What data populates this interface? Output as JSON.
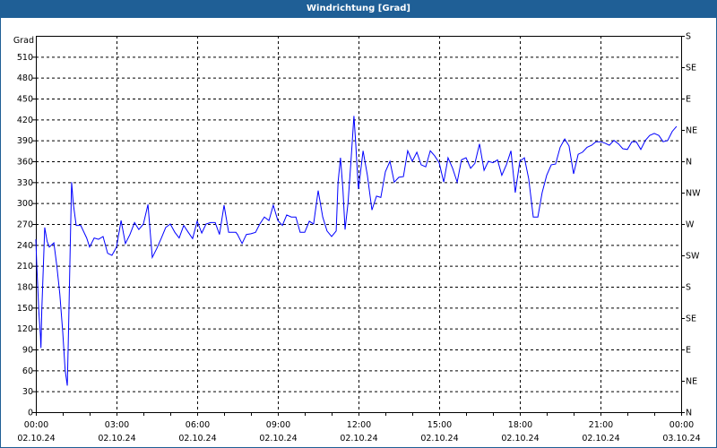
{
  "window": {
    "title": "Windrichtung [Grad]"
  },
  "colors": {
    "title_bar": "#1f5f96",
    "series": "#0000ff",
    "grid": "#000000"
  },
  "chart_data": {
    "type": "line",
    "title": "Windrichtung [Grad]",
    "ylabel": "Grad",
    "ylim": [
      0,
      540
    ],
    "xlim_hours": [
      0,
      24
    ],
    "grid": true,
    "y_ticks": [
      0,
      30,
      60,
      90,
      120,
      150,
      180,
      210,
      240,
      270,
      300,
      330,
      360,
      390,
      420,
      450,
      480,
      510
    ],
    "right_axis": [
      {
        "value": 0,
        "label": "N"
      },
      {
        "value": 45,
        "label": "NE"
      },
      {
        "value": 90,
        "label": "E"
      },
      {
        "value": 135,
        "label": "SE"
      },
      {
        "value": 180,
        "label": "S"
      },
      {
        "value": 225,
        "label": "SW"
      },
      {
        "value": 270,
        "label": "W"
      },
      {
        "value": 315,
        "label": "NW"
      },
      {
        "value": 360,
        "label": "N"
      },
      {
        "value": 405,
        "label": "NE"
      },
      {
        "value": 450,
        "label": "E"
      },
      {
        "value": 495,
        "label": "SE"
      },
      {
        "value": 540,
        "label": "S"
      }
    ],
    "x_ticks": [
      {
        "hour": 0,
        "time": "00:00",
        "date": "02.10.24"
      },
      {
        "hour": 3,
        "time": "03:00",
        "date": "02.10.24"
      },
      {
        "hour": 6,
        "time": "06:00",
        "date": "02.10.24"
      },
      {
        "hour": 9,
        "time": "09:00",
        "date": "02.10.24"
      },
      {
        "hour": 12,
        "time": "12:00",
        "date": "02.10.24"
      },
      {
        "hour": 15,
        "time": "15:00",
        "date": "02.10.24"
      },
      {
        "hour": 18,
        "time": "18:00",
        "date": "02.10.24"
      },
      {
        "hour": 21,
        "time": "21:00",
        "date": "02.10.24"
      },
      {
        "hour": 24,
        "time": "00:00",
        "date": "03.10.24"
      }
    ],
    "series": [
      {
        "name": "Windrichtung",
        "x": [
          0,
          0.03,
          0.11,
          0.17,
          0.19,
          0.22,
          0.28,
          0.33,
          0.42,
          0.5,
          0.67,
          0.78,
          0.89,
          1.0,
          1.09,
          1.17,
          1.22,
          1.28,
          1.33,
          1.39,
          1.5,
          1.67,
          1.89,
          2.0,
          2.17,
          2.33,
          2.5,
          2.67,
          2.83,
          3.0,
          3.17,
          3.33,
          3.5,
          3.67,
          3.83,
          4.0,
          4.17,
          4.33,
          4.5,
          4.67,
          4.83,
          5.0,
          5.17,
          5.33,
          5.5,
          5.67,
          5.83,
          6.0,
          6.17,
          6.33,
          6.5,
          6.67,
          6.83,
          7.0,
          7.17,
          7.44,
          7.5,
          7.67,
          7.83,
          8.0,
          8.17,
          8.33,
          8.5,
          8.67,
          8.83,
          9.0,
          9.17,
          9.33,
          9.5,
          9.67,
          9.83,
          10.0,
          10.17,
          10.33,
          10.5,
          10.67,
          10.83,
          11.0,
          11.17,
          11.24,
          11.33,
          11.42,
          11.5,
          11.61,
          11.72,
          11.83,
          11.89,
          11.98,
          12.0,
          12.17,
          12.33,
          12.5,
          12.67,
          12.83,
          13.0,
          13.17,
          13.33,
          13.5,
          13.67,
          13.83,
          14.0,
          14.17,
          14.33,
          14.5,
          14.67,
          14.83,
          15.0,
          15.17,
          15.33,
          15.5,
          15.67,
          15.83,
          16.0,
          16.17,
          16.33,
          16.5,
          16.67,
          16.83,
          17.0,
          17.17,
          17.33,
          17.5,
          17.67,
          17.83,
          18.0,
          18.17,
          18.33,
          18.5,
          18.67,
          18.83,
          19.0,
          19.17,
          19.33,
          19.5,
          19.67,
          19.83,
          20.0,
          20.17,
          20.33,
          20.5,
          20.67,
          20.83,
          21.0,
          21.17,
          21.33,
          21.5,
          21.67,
          21.83,
          22.0,
          22.17,
          22.33,
          22.5,
          22.67,
          22.83,
          23.0,
          23.17,
          23.33,
          23.5,
          23.67,
          23.83
        ],
        "y": [
          248,
          215,
          145,
          110,
          92,
          145,
          210,
          265,
          245,
          237,
          243,
          210,
          170,
          115,
          60,
          38,
          125,
          240,
          330,
          300,
          268,
          268,
          250,
          237,
          250,
          248,
          252,
          228,
          225,
          237,
          275,
          242,
          255,
          272,
          262,
          270,
          298,
          222,
          235,
          250,
          265,
          270,
          258,
          250,
          268,
          258,
          249,
          274,
          257,
          270,
          272,
          272,
          255,
          297,
          258,
          258,
          255,
          242,
          255,
          256,
          258,
          270,
          280,
          275,
          297,
          275,
          268,
          283,
          280,
          280,
          258,
          258,
          274,
          270,
          318,
          280,
          260,
          252,
          260,
          330,
          365,
          320,
          262,
          300,
          360,
          425,
          390,
          330,
          320,
          375,
          340,
          290,
          310,
          308,
          345,
          360,
          330,
          337,
          338,
          375,
          360,
          373,
          355,
          352,
          375,
          368,
          358,
          330,
          365,
          350,
          330,
          362,
          365,
          350,
          357,
          385,
          347,
          360,
          358,
          362,
          340,
          355,
          375,
          315,
          360,
          365,
          335,
          280,
          280,
          315,
          340,
          355,
          356,
          380,
          392,
          382,
          342,
          370,
          373,
          380,
          383,
          388,
          388,
          386,
          383,
          390,
          385,
          378,
          377,
          388,
          388,
          377,
          390,
          397,
          400,
          397,
          388,
          390,
          403,
          410
        ]
      }
    ]
  }
}
